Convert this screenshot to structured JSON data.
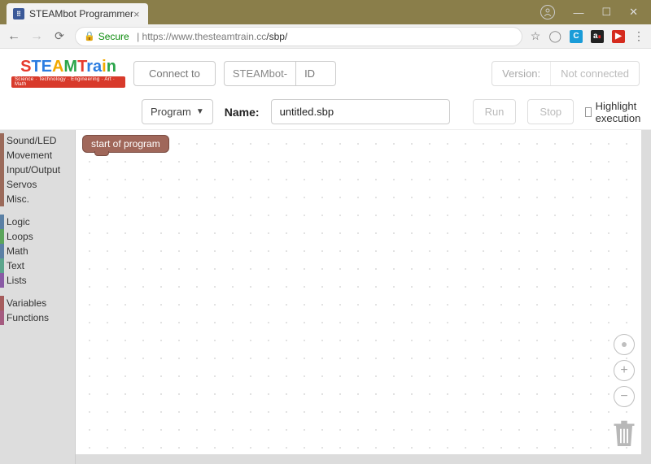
{
  "browser": {
    "tab_title": "STEAMbot Programmer",
    "secure_label": "Secure",
    "url_host": "https://www.thesteamtrain.cc",
    "url_path": "/sbp/"
  },
  "logo": {
    "text": "STEAMTrain",
    "subtitle": "Science · Technology · Engineering · Art · Math"
  },
  "toolbar": {
    "connect_label": "Connect to",
    "device_prefix": "STEAMbot-",
    "device_id_placeholder": "ID",
    "version_label": "Version:",
    "version_value": "Not connected",
    "menu_selected": "Program",
    "name_label": "Name:",
    "filename": "untitled.sbp",
    "run_label": "Run",
    "stop_label": "Stop",
    "highlight_label": "Highlight execution"
  },
  "categories": [
    {
      "label": "Sound/LED",
      "cls": "brown"
    },
    {
      "label": "Movement",
      "cls": "brown"
    },
    {
      "label": "Input/Output",
      "cls": "brown"
    },
    {
      "label": "Servos",
      "cls": "brown"
    },
    {
      "label": "Misc.",
      "cls": "brown"
    },
    {
      "gap": true
    },
    {
      "label": "Logic",
      "cls": "blue"
    },
    {
      "label": "Loops",
      "cls": "green"
    },
    {
      "label": "Math",
      "cls": "blue"
    },
    {
      "label": "Text",
      "cls": "teal"
    },
    {
      "label": "Lists",
      "cls": "purple"
    },
    {
      "gap": true
    },
    {
      "label": "Variables",
      "cls": "red"
    },
    {
      "label": "Functions",
      "cls": "darkpurple"
    }
  ],
  "canvas": {
    "start_block": "start of program"
  }
}
